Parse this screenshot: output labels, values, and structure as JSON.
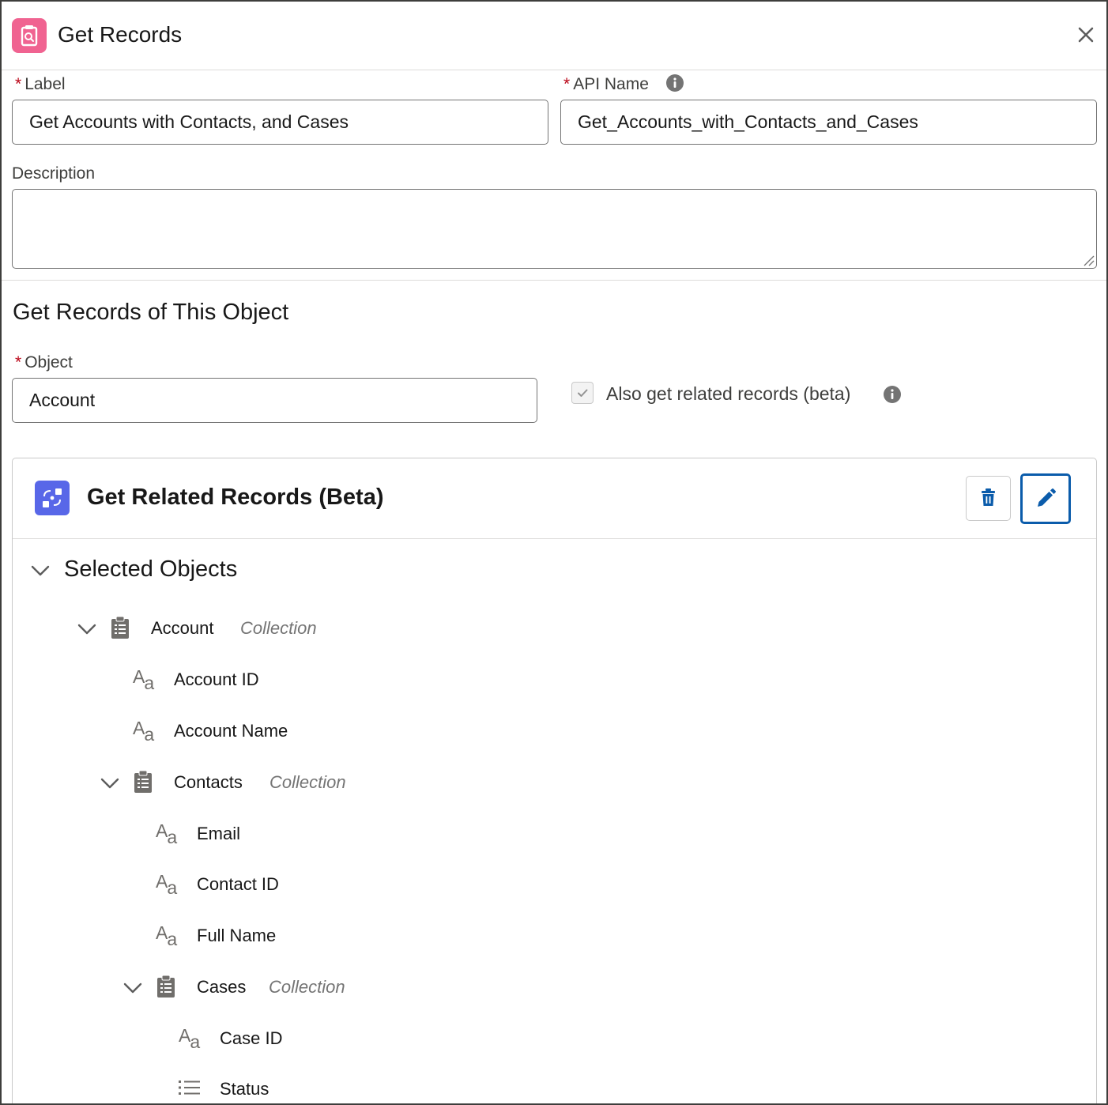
{
  "header": {
    "title": "Get Records",
    "icon": "get-records-icon",
    "icon_color": "#f06391"
  },
  "form": {
    "label": {
      "required_mark": "*",
      "label": "Label",
      "value": "Get Accounts with Contacts, and Cases"
    },
    "api_name": {
      "required_mark": "*",
      "label": "API Name",
      "value": "Get_Accounts_with_Contacts_and_Cases"
    },
    "description": {
      "label": "Description",
      "value": ""
    }
  },
  "object_section": {
    "title": "Get Records of This Object",
    "object": {
      "required_mark": "*",
      "label": "Object",
      "value": "Account"
    },
    "related_checkbox": {
      "label": "Also get related records (beta)",
      "checked": true
    }
  },
  "related_card": {
    "title": "Get Related Records (Beta)",
    "icon_color": "#5867e8",
    "accent_color": "#0b5cab",
    "selected_objects_label": "Selected Objects",
    "tree": {
      "account": {
        "label": "Account",
        "type": "Collection"
      },
      "account_fields": [
        "Account ID",
        "Account Name"
      ],
      "contacts": {
        "label": "Contacts",
        "type": "Collection"
      },
      "contact_fields": [
        "Email",
        "Contact ID",
        "Full Name"
      ],
      "cases": {
        "label": "Cases",
        "type": "Collection"
      },
      "case_fields": [
        "Case ID",
        "Status"
      ]
    }
  }
}
